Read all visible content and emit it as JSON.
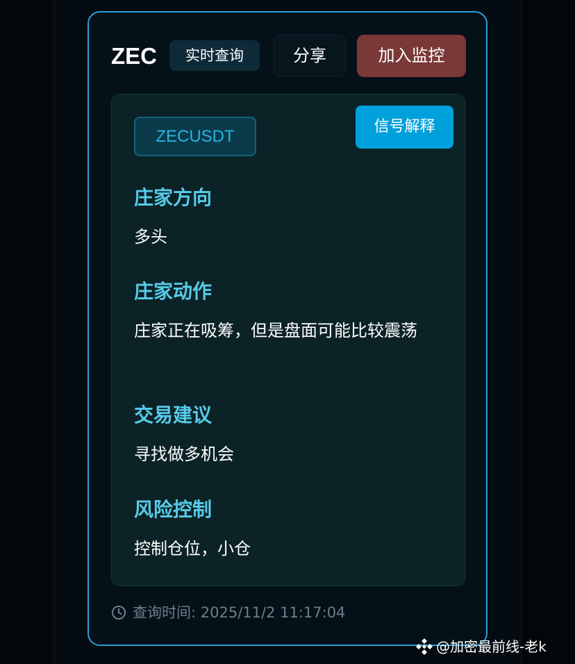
{
  "header": {
    "coin": "ZEC",
    "mode_tag": "实时查询",
    "share_label": "分享",
    "monitor_label": "加入监控"
  },
  "panel": {
    "symbol": "ZECUSDT",
    "explain_label": "信号解释",
    "sections": [
      {
        "title": "庄家方向",
        "body": "多头"
      },
      {
        "title": "庄家动作",
        "body": "庄家正在吸筹，但是盘面可能比较震荡"
      },
      {
        "title": "交易建议",
        "body": "寻找做多机会"
      },
      {
        "title": "风险控制",
        "body": "控制仓位，小仓"
      }
    ]
  },
  "footer": {
    "query_time": "查询时间: 2025/11/2 11:17:04",
    "icon": "clock-icon"
  },
  "watermark": {
    "text": "@加密最前线-老k",
    "icon": "binance-logo-icon"
  },
  "colors": {
    "accent_border": "#2d9ed6",
    "monitor_button": "#7a3837",
    "explain_button": "#00a0dc",
    "section_title": "#57cae8",
    "symbol_text": "#27b4e4"
  }
}
